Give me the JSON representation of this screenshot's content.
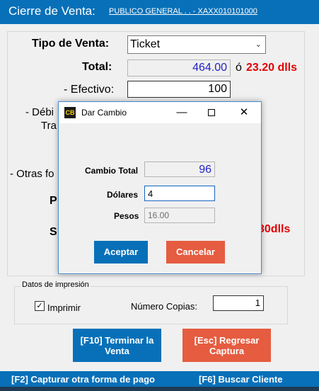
{
  "header": {
    "title": "Cierre de Venta:",
    "client_link": "PUBLICO GENERAL . . - XAXX010101000"
  },
  "form": {
    "tipo_label": "Tipo de Venta:",
    "tipo_value": "Ticket",
    "total_label": "Total:",
    "total_value": "464.00",
    "total_sep": "ó",
    "total_dlls": "23.20 dlls",
    "efectivo_label": "- Efectivo:",
    "efectivo_value": "100",
    "debito_partial": "- Débi",
    "tran_partial": "Tra",
    "otras_partial": "- Otras fo",
    "p_partial": "P",
    "s_partial": "S",
    "dlls_partial": "30dlls"
  },
  "print_group": {
    "title": "Datos de impresión",
    "imprimir_label": "Imprimir",
    "copias_label": "Número Copias:",
    "copias_value": "1"
  },
  "actions": {
    "terminar_line1": "[F10] Terminar la",
    "terminar_line2": "Venta",
    "regresar_line1": "[Esc] Regresar",
    "regresar_line2": "Captura"
  },
  "footer": {
    "f2": "[F2] Capturar otra forma de pago",
    "f6": "[F6] Buscar Cliente"
  },
  "dialog": {
    "logo": "CB",
    "title": "Dar Cambio",
    "cambio_label": "Cambio Total",
    "cambio_value": "96",
    "dolares_label": "Dólares",
    "dolares_value": "4",
    "pesos_label": "Pesos",
    "pesos_value": "16.00",
    "accept": "Aceptar",
    "cancel": "Cancelar"
  },
  "colors": {
    "accent": "#0870b8",
    "danger": "#e55c40",
    "amount": "#2323c8",
    "dlls": "#e30000"
  }
}
